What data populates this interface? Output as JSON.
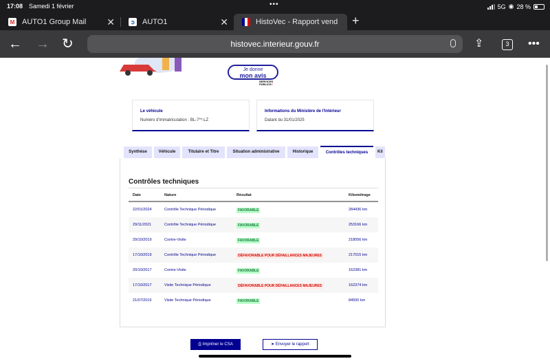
{
  "status": {
    "time": "17:08",
    "date": "Samedi 1 février",
    "network": "5G",
    "battery": "28 %"
  },
  "tabs": [
    {
      "label": "AUTO1 Group Mail",
      "icon": "gmail-icon"
    },
    {
      "label": "AUTO1",
      "icon": "auto1-icon"
    },
    {
      "label": "HistoVec - Rapport vend",
      "icon": "histovec-icon"
    }
  ],
  "toolbar": {
    "url": "histovec.interieur.gouv.fr",
    "tab_count": "3"
  },
  "feedback": {
    "line1": "Je donne",
    "line2": "mon avis",
    "services": "SERVICES\nPUBLICS+"
  },
  "cards": [
    {
      "title": "Le véhicule",
      "value": "Numéro d'immatriculation : BL-7**-LZ"
    },
    {
      "title": "Informations du Ministère de l'Intérieur",
      "value": "Datant du 31/01/2025"
    }
  ],
  "section_tabs": [
    "Synthèse",
    "Véhicule",
    "Titulaire et Titre",
    "Situation administrative",
    "Historique",
    "Contrôles techniques",
    "Kil"
  ],
  "controles": {
    "title": "Contrôles techniques",
    "headers": [
      "Date",
      "Nature",
      "Résultat",
      "Kilométrage"
    ],
    "rows": [
      [
        "22/01/2024",
        "Contrôle Technique Périodique",
        "FAVORABLE",
        "284436 km"
      ],
      [
        "29/11/2021",
        "Contrôle Technique Périodique",
        "FAVORABLE",
        "253166 km"
      ],
      [
        "29/10/2019",
        "Contre-Visite",
        "FAVORABLE",
        "218056 km"
      ],
      [
        "17/10/2019",
        "Contrôle Technique Périodique",
        "DÉFAVORABLE POUR DÉFAILLANCES MAJEURES",
        "217015 km"
      ],
      [
        "20/10/2017",
        "Contre-Visite",
        "FAVORABLE",
        "162381 km"
      ],
      [
        "17/10/2017",
        "Visite Technique Périodique",
        "DÉFAVORABLE POUR DÉFAILLANCES MAJEURES",
        "162374 km"
      ],
      [
        "21/07/2015",
        "Visite Technique Périodique",
        "FAVORABLE",
        "84500 km"
      ]
    ]
  },
  "buttons": {
    "print": "Imprimer le CSA",
    "send": "Envoyer le rapport"
  },
  "colors": {
    "brand_blue": "#000091",
    "favorable": "#18753c",
    "defavorable": "#ce0500"
  }
}
